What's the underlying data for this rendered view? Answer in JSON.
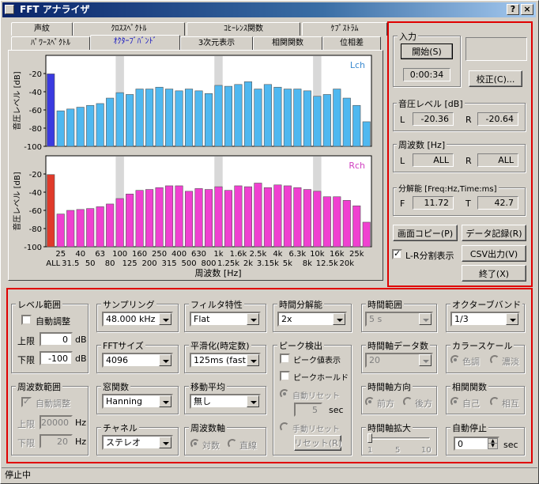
{
  "window": {
    "title": "FFT アナライザ",
    "help": "?",
    "close": "×"
  },
  "tabs_row1": [
    "声紋",
    "ｸﾛｽｽﾍﾟｸﾄﾙ",
    "ｺﾋｰﾚﾝｽ関数",
    "ｹﾌﾟｽﾄﾗﾑ"
  ],
  "tabs_row2": [
    "ﾊﾟﾜｰｽﾍﾟｸﾄﾙ",
    "ｵｸﾀｰﾌﾞﾊﾞﾝﾄﾞ",
    "3次元表示",
    "相関関数",
    "位相差"
  ],
  "chart_data": [
    {
      "type": "bar",
      "channel": "Lch",
      "ylabel": "音圧レベル [dB]",
      "yticks": [
        -20,
        -40,
        -60,
        -80,
        -100
      ],
      "ylim": [
        -100,
        0
      ],
      "categories": [
        "ALL",
        "25",
        "31.5",
        "40",
        "50",
        "63",
        "80",
        "100",
        "125",
        "160",
        "200",
        "250",
        "315",
        "400",
        "500",
        "630",
        "800",
        "1k",
        "1.25k",
        "1.6k",
        "2k",
        "2.5k",
        "3.15k",
        "4k",
        "5k",
        "6.3k",
        "8k",
        "10k",
        "12.5k",
        "16k",
        "20k"
      ],
      "values": [
        -20.36,
        -61,
        -59,
        -57,
        -55,
        -53,
        -47,
        -41,
        -43,
        -37,
        -37,
        -35,
        -37,
        -39,
        -37,
        -39,
        -42,
        -33,
        -34,
        -32,
        -29,
        -37,
        -32,
        -35,
        -37,
        -37,
        -39,
        -45,
        -43,
        -37,
        -47,
        -55,
        -73
      ],
      "color": "#4fb8f0",
      "all_color": "#3a3ae0",
      "band_highlights": [
        "100",
        "1k",
        "10k"
      ]
    },
    {
      "type": "bar",
      "channel": "Rch",
      "ylabel": "音圧レベル [dB]",
      "yticks": [
        -20,
        -40,
        -60,
        -80,
        -100
      ],
      "ylim": [
        -100,
        0
      ],
      "categories": [
        "ALL",
        "25",
        "31.5",
        "40",
        "50",
        "63",
        "80",
        "100",
        "125",
        "160",
        "200",
        "250",
        "315",
        "400",
        "500",
        "630",
        "800",
        "1k",
        "1.25k",
        "1.6k",
        "2k",
        "2.5k",
        "3.15k",
        "4k",
        "5k",
        "6.3k",
        "8k",
        "10k",
        "12.5k",
        "16k",
        "20k"
      ],
      "values": [
        -20.64,
        -64,
        -60,
        -59,
        -58,
        -56,
        -53,
        -47,
        -42,
        -38,
        -37,
        -35,
        -33,
        -33,
        -39,
        -36,
        -37,
        -34,
        -38,
        -33,
        -34,
        -30,
        -35,
        -32,
        -33,
        -35,
        -37,
        -39,
        -45,
        -45,
        -49,
        -55,
        -73
      ],
      "color": "#f040d0",
      "all_color": "#e03a2a",
      "band_highlights": [
        "100",
        "1k",
        "10k"
      ]
    }
  ],
  "xaxis": {
    "top": [
      "25",
      "40",
      "63",
      "100",
      "160",
      "250",
      "400",
      "630",
      "1k",
      "1.6k",
      "2.5k",
      "4k",
      "6.3k",
      "10k",
      "16k",
      "25k"
    ],
    "bottom": [
      "ALL",
      "31.5",
      "50",
      "80",
      "125",
      "200",
      "315",
      "500",
      "800",
      "1.25k",
      "2k",
      "3.15k",
      "5k",
      "8k",
      "12.5k",
      "20k"
    ],
    "label": "周波数 [Hz]"
  },
  "right": {
    "input": {
      "title": "入力",
      "start": "開始(S)",
      "time": "0:00:34",
      "calibrate": "校正(C)..."
    },
    "level": {
      "title": "音圧レベル [dB]",
      "l": "L",
      "lval": "-20.36",
      "r": "R",
      "rval": "-20.64"
    },
    "freq": {
      "title": "周波数 [Hz]",
      "l": "L",
      "lval": "ALL",
      "r": "R",
      "rval": "ALL"
    },
    "res": {
      "title": "分解能 [Freq:Hz,Time:ms]",
      "f": "F",
      "fval": "11.72",
      "t": "T",
      "tval": "42.7"
    },
    "copy": "画面コピー(P)",
    "record": "データ記録(R)",
    "lr_split": "L-R分割表示",
    "csv": "CSV出力(V)",
    "exit": "終了(X)"
  },
  "settings": {
    "level_range": {
      "title": "レベル範囲",
      "auto": "自動調整",
      "upper": "上限",
      "upper_val": "0",
      "lower": "下限",
      "lower_val": "-100",
      "unit": "dB"
    },
    "freq_range": {
      "title": "周波数範囲",
      "auto": "自動調整",
      "upper": "上限",
      "upper_val": "20000",
      "lower": "下限",
      "lower_val": "20",
      "unit": "Hz"
    },
    "sampling": {
      "title": "サンプリング",
      "value": "48.000 kHz"
    },
    "fft_size": {
      "title": "FFTサイズ",
      "value": "4096"
    },
    "window_fn": {
      "title": "窓関数",
      "value": "Hanning"
    },
    "channel": {
      "title": "チャネル",
      "value": "ステレオ"
    },
    "filter": {
      "title": "フィルタ特性",
      "value": "Flat"
    },
    "smoothing": {
      "title": "平滑化(時定数)",
      "value": "125ms (fast)"
    },
    "moving_avg": {
      "title": "移動平均",
      "value": "無し"
    },
    "freq_axis": {
      "title": "周波数軸",
      "log": "対数",
      "linear": "直線"
    },
    "time_res": {
      "title": "時間分解能",
      "value": "2x"
    },
    "peak": {
      "title": "ピーク検出",
      "show": "ピーク値表示",
      "hold": "ピークホールド",
      "auto_reset": "自動リセット",
      "auto_val": "5",
      "sec": "sec",
      "manual_reset": "手動リセット",
      "reset_btn": "リセット(R)"
    },
    "time_range": {
      "title": "時間範囲",
      "value": "5 s"
    },
    "time_data_count": {
      "title": "時間軸データ数",
      "value": "20"
    },
    "time_dir": {
      "title": "時間軸方向",
      "fwd": "前方",
      "back": "後方"
    },
    "time_zoom": {
      "title": "時間軸拡大",
      "t1": "1",
      "t5": "5",
      "t10": "10"
    },
    "octave": {
      "title": "オクターブバンド",
      "value": "1/3"
    },
    "color_scale": {
      "title": "カラースケール",
      "color": "色調",
      "shade": "濃淡"
    },
    "corr": {
      "title": "相関関数",
      "self": "自己",
      "mutual": "相互"
    },
    "auto_stop": {
      "title": "自動停止",
      "value": "0",
      "sec": "sec"
    }
  },
  "status": "停止中"
}
